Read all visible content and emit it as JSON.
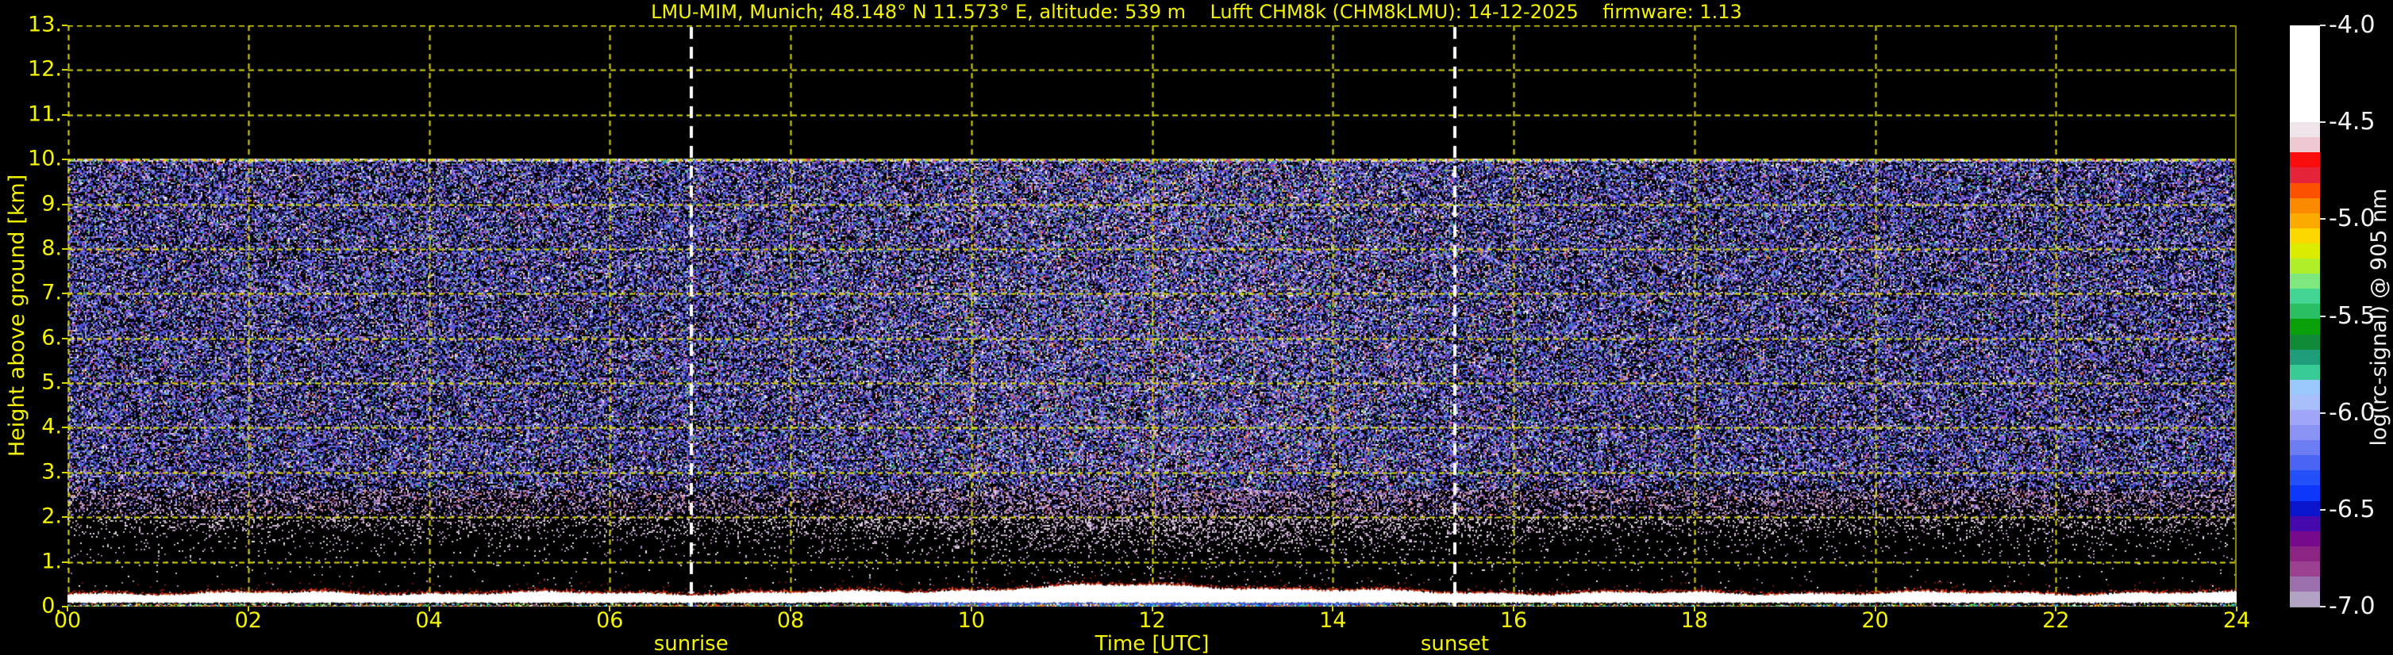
{
  "figure": {
    "background": "#000000",
    "accent_color": "#f4f400",
    "title": "LMU-MIM, Munich; 48.148° N 11.573° E, altitude: 539 m    Lufft CHM8k (CHM8kLMU): 14-12-2025    firmware: 1.13"
  },
  "chart_data": {
    "type": "heatmap",
    "title": "LMU-MIM, Munich; 48.148° N 11.573° E, altitude: 539 m    Lufft CHM8k (CHM8kLMU): 14-12-2025    firmware: 1.13",
    "xlabel": "Time [UTC]",
    "ylabel": "Height above ground [km]",
    "xlim": [
      0,
      24
    ],
    "ylim": [
      0,
      13
    ],
    "grid": "dashed yellow, 1 km horizontal spacing, 2 h vertical spacing",
    "grid_color": "#d8d800",
    "x_ticks": [
      {
        "label": "00",
        "hour": 0
      },
      {
        "label": "02",
        "hour": 2
      },
      {
        "label": "04",
        "hour": 4
      },
      {
        "label": "06",
        "hour": 6
      },
      {
        "label": "08",
        "hour": 8
      },
      {
        "label": "10",
        "hour": 10
      },
      {
        "label": "12",
        "hour": 12
      },
      {
        "label": "14",
        "hour": 14
      },
      {
        "label": "16",
        "hour": 16
      },
      {
        "label": "18",
        "hour": 18
      },
      {
        "label": "20",
        "hour": 20
      },
      {
        "label": "22",
        "hour": 22
      },
      {
        "label": "24",
        "hour": 24
      }
    ],
    "y_ticks": [
      {
        "label": "0.",
        "km": 0
      },
      {
        "label": "1.",
        "km": 1
      },
      {
        "label": "2.",
        "km": 2
      },
      {
        "label": "3.",
        "km": 3
      },
      {
        "label": "4.",
        "km": 4
      },
      {
        "label": "5.",
        "km": 5
      },
      {
        "label": "6.",
        "km": 6
      },
      {
        "label": "7.",
        "km": 7
      },
      {
        "label": "8.",
        "km": 8
      },
      {
        "label": "9.",
        "km": 9
      },
      {
        "label": "10.",
        "km": 10
      },
      {
        "label": "11.",
        "km": 11
      },
      {
        "label": "12.",
        "km": 12
      },
      {
        "label": "13.",
        "km": 13
      }
    ],
    "annotations": [
      {
        "label": "sunrise",
        "hour": 6.9,
        "line_color": "#ffffff",
        "line_style": "dashed"
      },
      {
        "label": "sunset",
        "hour": 15.35,
        "line_color": "#ffffff",
        "line_style": "dashed"
      }
    ],
    "colorbar": {
      "label": "log(rc-signal) @ 905 nm",
      "range_top": -4.0,
      "range_bottom": -7.0,
      "tick_labels": [
        "-4.0",
        "-4.5",
        "-5.0",
        "-5.5",
        "-6.0",
        "-6.5",
        "-7.0"
      ],
      "tick_values": [
        -4.0,
        -4.5,
        -5.0,
        -5.5,
        -6.0,
        -6.5,
        -7.0
      ],
      "top_block_color": "#ffffff",
      "top_block_fraction": 0.1667,
      "segments": [
        "#efe4ea",
        "#eec9d2",
        "#fb0d0d",
        "#e62439",
        "#fc5200",
        "#fc8a00",
        "#fcaa00",
        "#fcd800",
        "#dcec00",
        "#b0ee2a",
        "#7ee87e",
        "#42d593",
        "#2abf62",
        "#09a009",
        "#118a38",
        "#1f9c7a",
        "#38cb96",
        "#9ac8fd",
        "#a9bffb",
        "#a2a6f8",
        "#8a92f4",
        "#6c7cf2",
        "#4a64f6",
        "#2450fa",
        "#0d38fc",
        "#0a14cc",
        "#4408ac",
        "#770a8c",
        "#8c2484",
        "#9c4092",
        "#9c70ac",
        "#b2a2c4"
      ]
    },
    "field": {
      "description": "Range-corrected ceilometer signal: uniform purple/blue speckle noise from 0-10 km, pure black above 10 km, signal fading below ~3 km to near-black at 1 km, bright white ground echo near 0.15 km with a midday boundary-layer bump (blue layer) between ~09:30 and ~14:30 UTC",
      "noise_top_km": 10,
      "ground_band_km": [
        0.08,
        0.3
      ],
      "bl_bump": {
        "start_hour": 9.5,
        "peak_hour": 11.85,
        "end_hour": 14.8,
        "peak_km": 0.33
      },
      "day_brightening_peak_hour": 12.2,
      "palettes": {
        "blue": [
          "#3434aa",
          "#4444cc",
          "#5454e0",
          "#6464ec",
          "#2a2a88",
          "#4858d8",
          "#3868cc"
        ],
        "lavender": [
          "#8888e0",
          "#9898ec",
          "#a8a8f0",
          "#7878d8",
          "#b0a8e8"
        ],
        "violet": [
          "#7a44c4",
          "#9150d4",
          "#a858dc",
          "#b862cc",
          "#6a3aa8"
        ],
        "warm": [
          "#c84444",
          "#dc5858",
          "#e07828",
          "#d8a838",
          "#cc4888",
          "#e8b0c0"
        ],
        "green": [
          "#38b070",
          "#2ab8a0",
          "#74c048",
          "#a4d048",
          "#188858"
        ],
        "bright": [
          "#e8e8f4",
          "#ffffff",
          "#d0e8f0",
          "#f0d0e0"
        ],
        "mauve": [
          "#a878a8",
          "#b88cb8",
          "#986898",
          "#c49cc4",
          "#8a5890"
        ],
        "mauve_low": [
          "#a888b0",
          "#b89cc0",
          "#c8b0d0",
          "#9878a8",
          "#d8ccd8",
          "#e8e0e8"
        ],
        "pinkwhite": [
          "#e0c8dc",
          "#eedae8"
        ],
        "ground_white": "#ffffff",
        "ground_red_cap": [
          "#b01c08",
          "#d42c0c",
          "#8a1404",
          "#e84c14"
        ],
        "ground_blue_layer": [
          "#2e52d6",
          "#1a36b0",
          "#4668e8",
          "#6a88f0",
          "#10248c"
        ],
        "ground_speckle": [
          "#30c8e8",
          "#e8e830",
          "#e84030",
          "#3858e8",
          "#38c848",
          "#e8e8e8",
          "#e87820"
        ]
      }
    }
  }
}
